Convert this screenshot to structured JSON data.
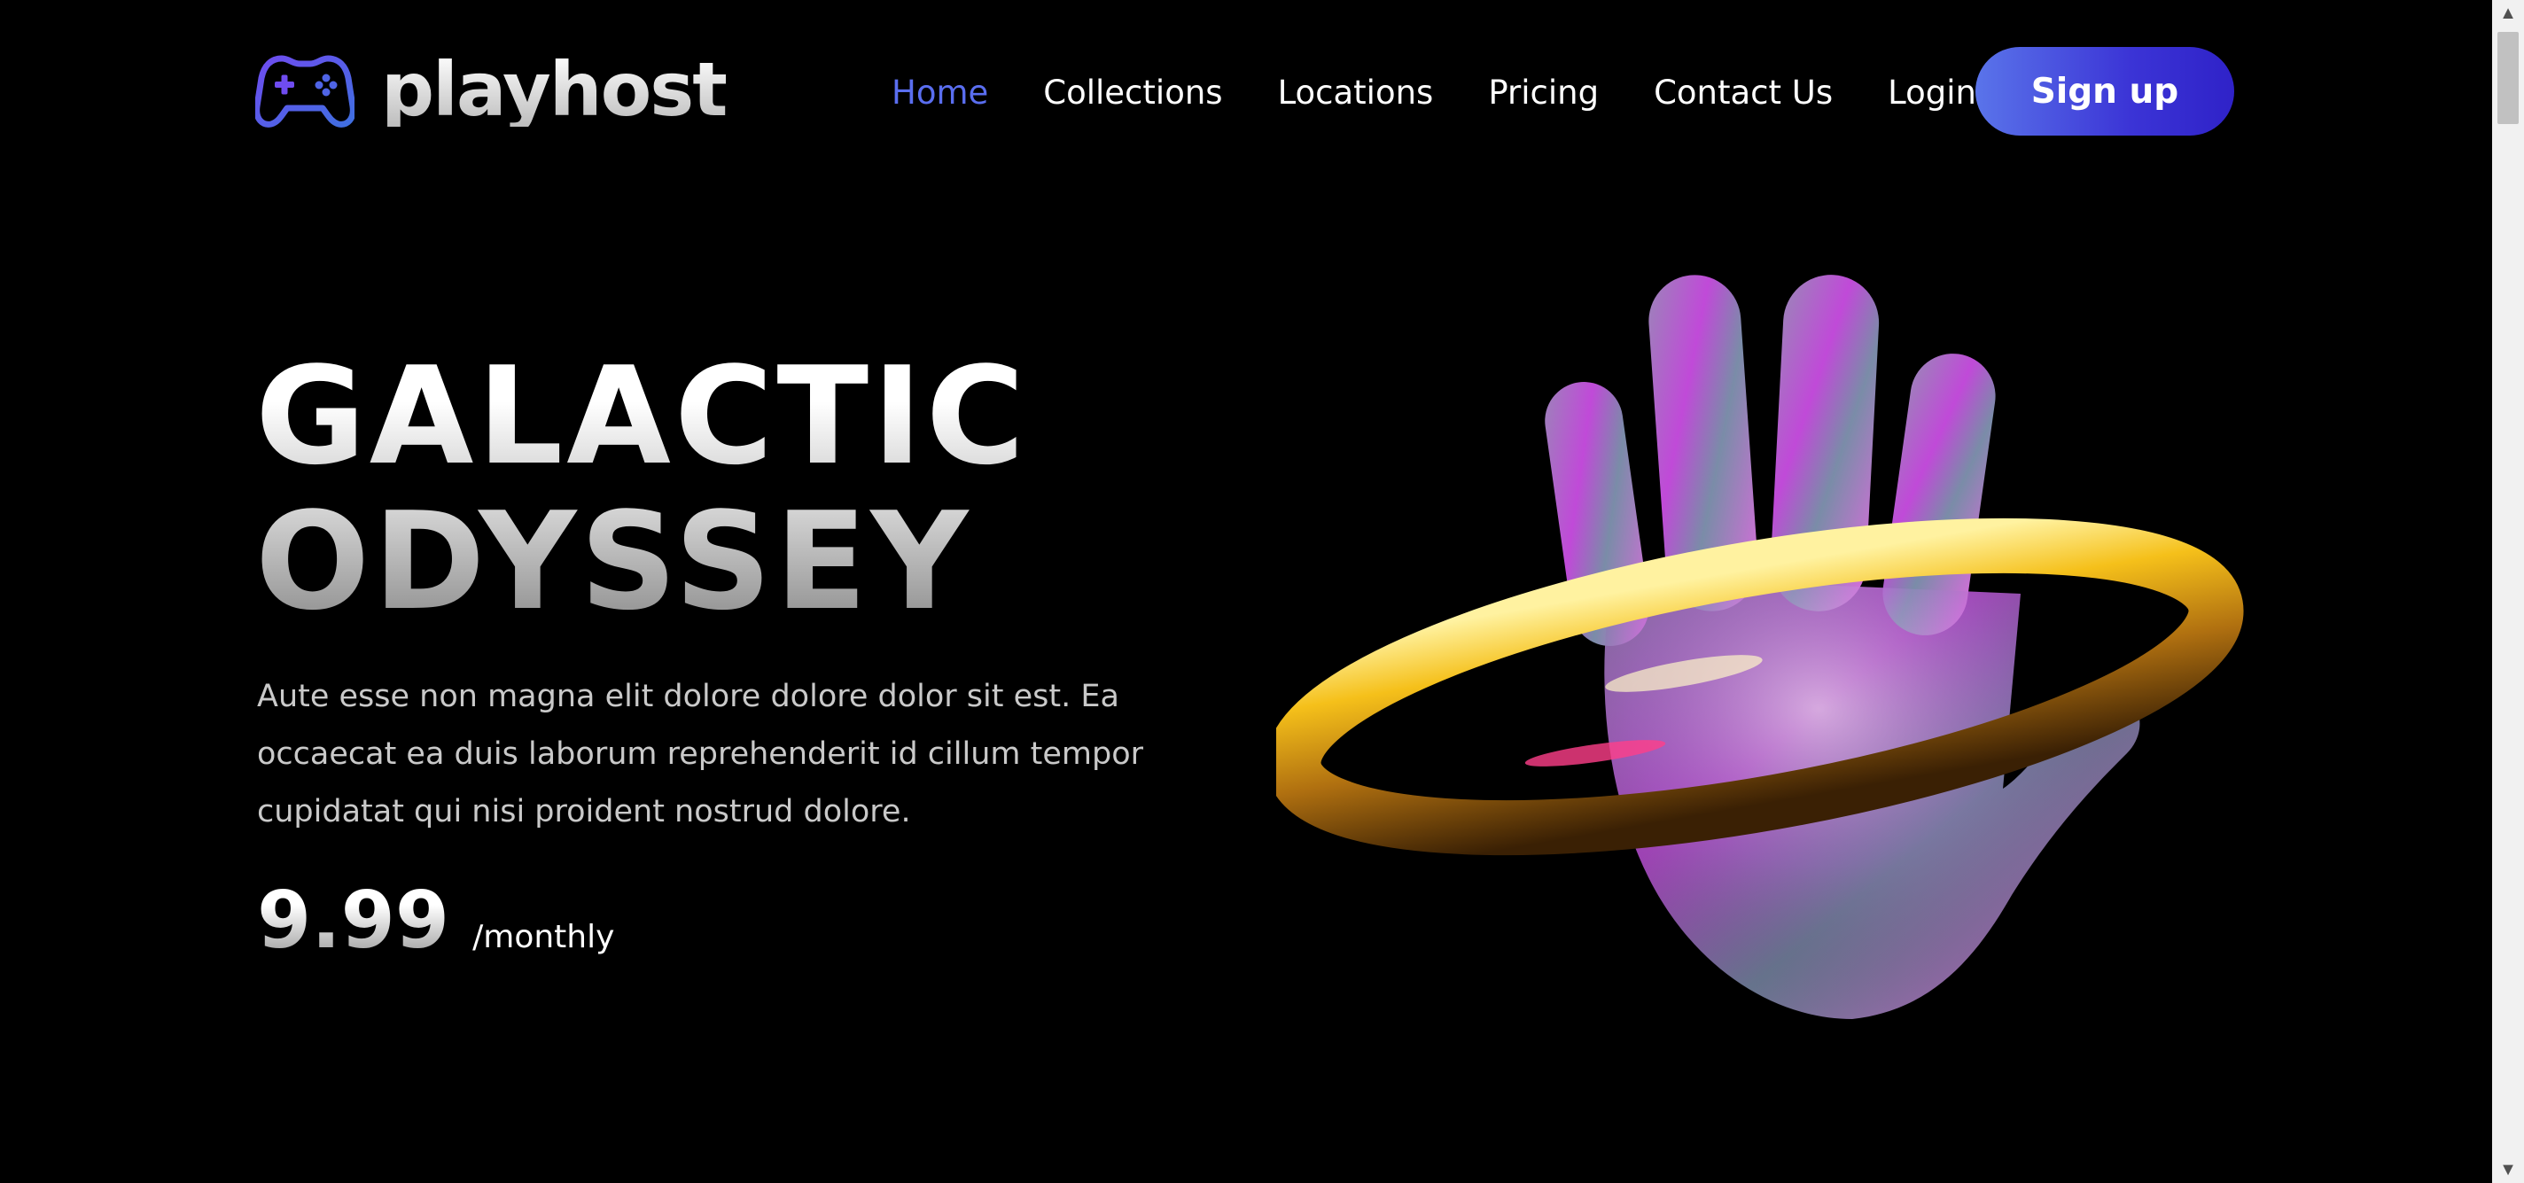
{
  "brand": {
    "name": "playhost",
    "icon": "gamepad-icon",
    "accent": "#5a6ef0"
  },
  "nav": {
    "items": [
      {
        "label": "Home",
        "active": true
      },
      {
        "label": "Collections",
        "active": false
      },
      {
        "label": "Locations",
        "active": false
      },
      {
        "label": "Pricing",
        "active": false
      },
      {
        "label": "Contact Us",
        "active": false
      },
      {
        "label": "Login",
        "active": false
      }
    ],
    "signup_label": "Sign up"
  },
  "hero": {
    "title_line1": "GALACTIC",
    "title_line2": "ODYSSEY",
    "description": "Aute esse non magna elit dolore dolore dolor sit est. Ea occaecat ea duis laborum reprehenderit id cillum tempor cupidatat qui nisi proident nostrud dolore.",
    "price": "9.99",
    "period": "/monthly",
    "image": "iridescent-glass-hand-with-gold-ring"
  },
  "colors": {
    "background": "#000000",
    "button_start": "#5a74ea",
    "button_end": "#2f22c8"
  }
}
